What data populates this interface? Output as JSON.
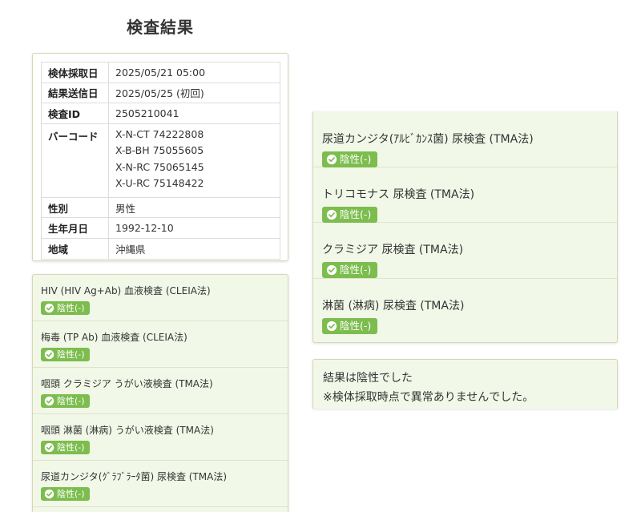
{
  "page": {
    "title": "検査結果"
  },
  "patient_info": {
    "rows": [
      {
        "label": "検体採取日",
        "value": "2025/05/21 05:00"
      },
      {
        "label": "結果送信日",
        "value": "2025/05/25 (初回)"
      },
      {
        "label": "検査ID",
        "value": "2505210041"
      },
      {
        "label": "バーコード",
        "values": [
          "X-N-CT 74222808",
          "X-B-BH 75055605",
          "X-N-RC 75065145",
          "X-U-RC 75148422"
        ]
      },
      {
        "label": "性別",
        "value": "男性"
      },
      {
        "label": "生年月日",
        "value": "1992-12-10"
      },
      {
        "label": "地域",
        "value": "沖縄県"
      }
    ]
  },
  "results_left": [
    {
      "name": "HIV (HIV Ag+Ab) 血液検査 (CLEIA法)",
      "result": "陰性(-)"
    },
    {
      "name": "梅毒 (TP Ab) 血液検査 (CLEIA法)",
      "result": "陰性(-)"
    },
    {
      "name": "咽頭 クラミジア うがい液検査 (TMA法)",
      "result": "陰性(-)"
    },
    {
      "name": "咽頭 淋菌 (淋病) うがい液検査 (TMA法)",
      "result": "陰性(-)"
    },
    {
      "name": "尿道カンジタ(ｸﾞﾗﾌﾞﾗｰﾀ菌) 尿検査 (TMA法)",
      "result": "陰性(-)"
    }
  ],
  "results_right": [
    {
      "name": "尿道カンジタ(ｱﾙﾋﾞｶﾝｽ菌) 尿検査 (TMA法)",
      "result": "陰性(-)"
    },
    {
      "name": "トリコモナス 尿検査 (TMA法)",
      "result": "陰性(-)"
    },
    {
      "name": "クラミジア 尿検査 (TMA法)",
      "result": "陰性(-)"
    },
    {
      "name": "淋菌 (淋病) 尿検査 (TMA法)",
      "result": "陰性(-)"
    }
  ],
  "summary": {
    "lines": [
      "結果は陰性でした",
      "※検体採取時点で異常ありませんでした。"
    ]
  },
  "colors": {
    "badge_green": "#7cbd4e",
    "card_green_bg": "#f2f8e8",
    "card_border": "#d8d6b4"
  },
  "icons": {
    "result_badge": "check-circle-icon"
  }
}
